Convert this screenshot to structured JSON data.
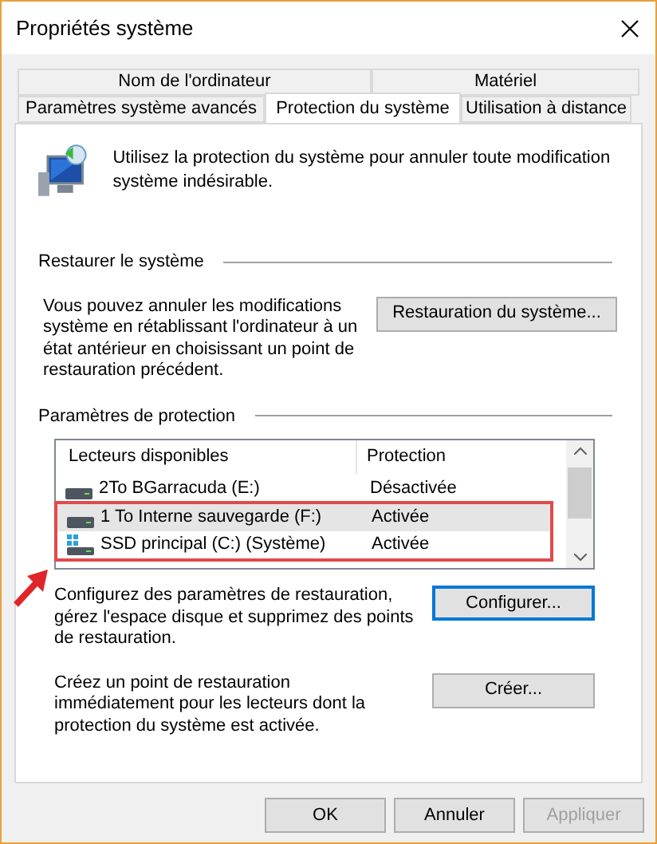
{
  "window": {
    "title": "Propriétés système"
  },
  "tabs_row_1": [
    {
      "label": "Nom de l'ordinateur",
      "selected": false
    },
    {
      "label": "Matériel",
      "selected": false
    }
  ],
  "tabs_row_2": [
    {
      "label": "Paramètres système avancés",
      "selected": false
    },
    {
      "label": "Protection du système",
      "selected": true
    },
    {
      "label": "Utilisation à distance",
      "selected": false
    }
  ],
  "intro": "Utilisez la protection du système pour annuler toute modification système indésirable.",
  "restore": {
    "heading": "Restaurer le système",
    "description": "Vous pouvez annuler les modifications système en rétablissant l'ordinateur à un état antérieur en choisissant un point de restauration précédent.",
    "button": "Restauration du système..."
  },
  "protection": {
    "heading": "Paramètres de protection",
    "columns": [
      "Lecteurs disponibles",
      "Protection"
    ],
    "drives": [
      {
        "name": "2To BGarracuda (E:)",
        "protection": "Désactivée",
        "kind": "disk",
        "selected": false,
        "highlighted": false
      },
      {
        "name": "1 To Interne sauvegarde (F:)",
        "protection": "Activée",
        "kind": "disk",
        "selected": true,
        "highlighted": true
      },
      {
        "name": "SSD principal (C:) (Système)",
        "protection": "Activée",
        "kind": "system",
        "selected": false,
        "highlighted": true
      }
    ],
    "configure": {
      "description": "Configurez des paramètres de restauration, gérez l'espace disque et supprimez des points de restauration.",
      "button": "Configurer...",
      "focused": true
    },
    "create": {
      "description": "Créez un point de restauration immédiatement pour les lecteurs dont la protection du système est activée.",
      "button": "Créer...",
      "focused": false
    }
  },
  "buttons": [
    {
      "label": "OK",
      "disabled": false
    },
    {
      "label": "Annuler",
      "disabled": false
    },
    {
      "label": "Appliquer",
      "disabled": true
    }
  ]
}
